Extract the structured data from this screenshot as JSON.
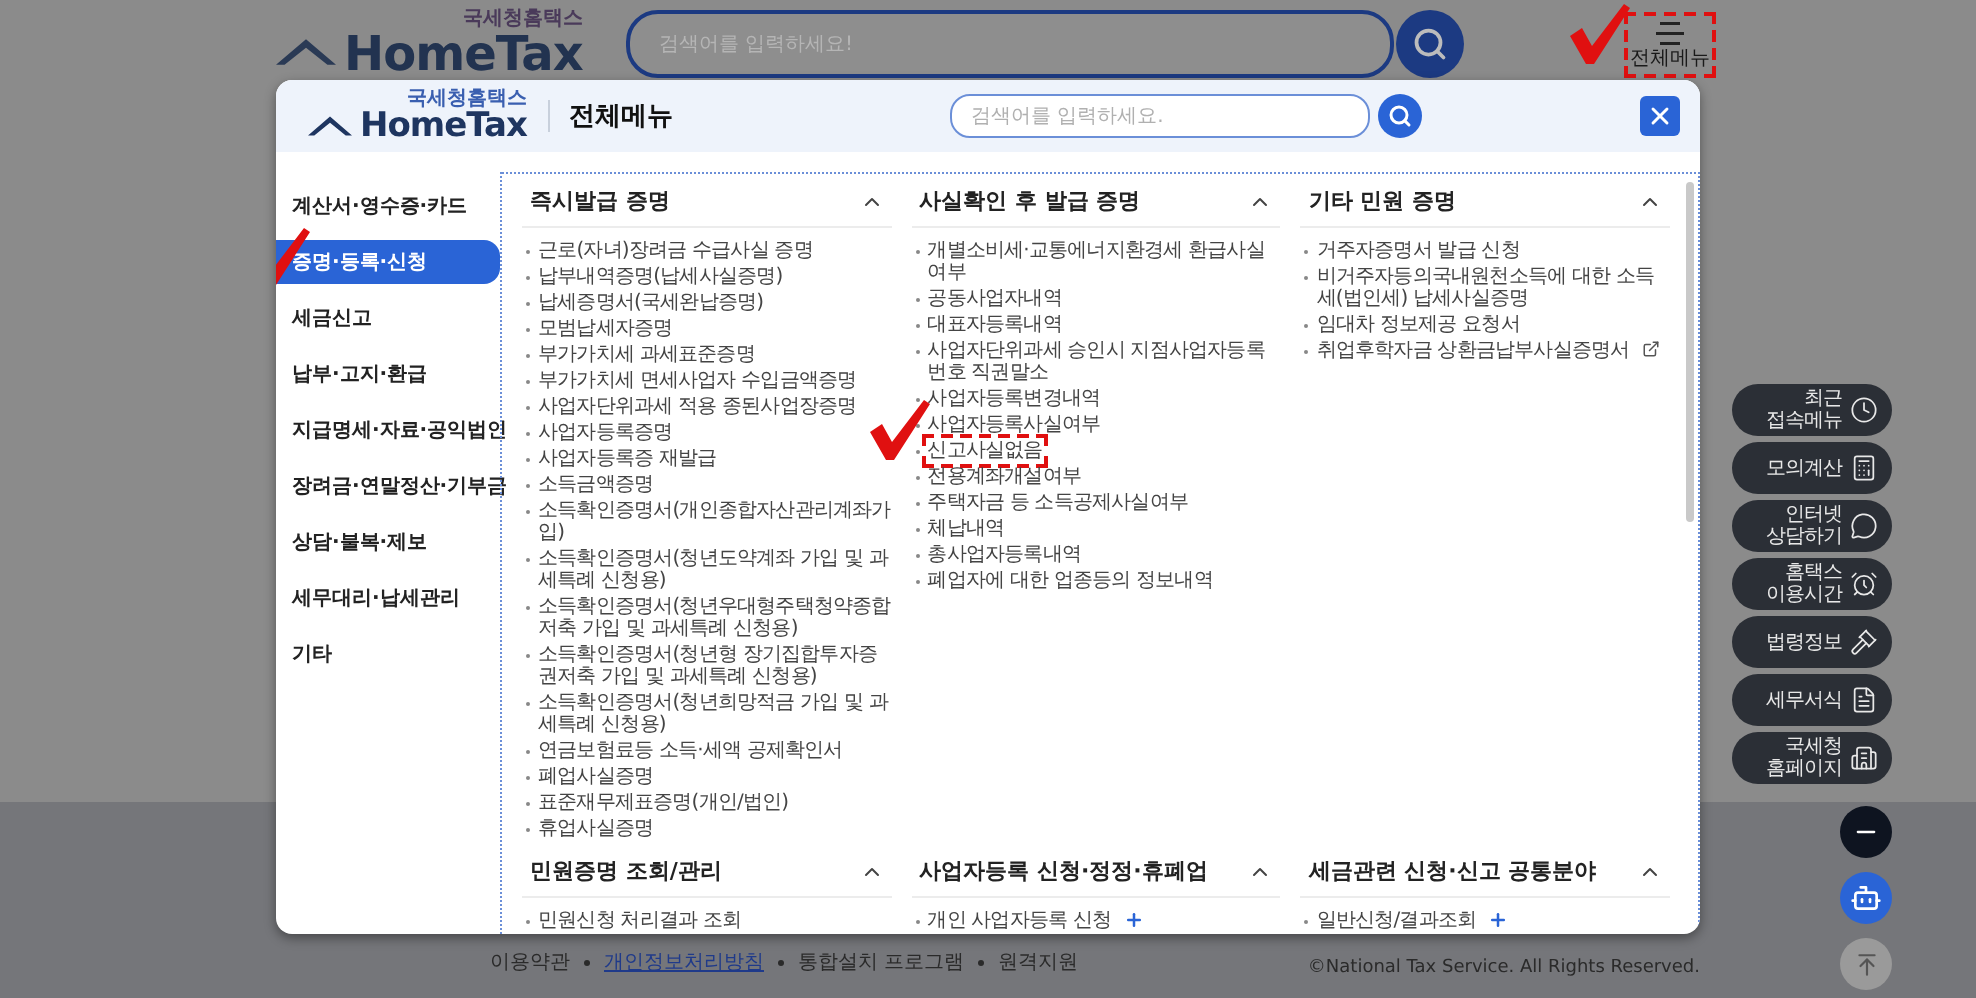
{
  "header": {
    "logo": {
      "tagline": "국세청홈택스",
      "name": "HomeTax"
    },
    "search": {
      "placeholder": "검색어를 입력하세요!"
    },
    "menu_button": {
      "label": "전체메뉴",
      "marked": true
    }
  },
  "modal": {
    "logo": {
      "tagline": "국세청홈택스",
      "name": "HomeTax"
    },
    "title": "전체메뉴",
    "search": {
      "placeholder": "검색어를 입력하세요."
    },
    "sidebar": [
      {
        "label": "계산서·영수증·카드",
        "selected": false,
        "marked": false
      },
      {
        "label": "증명·등록·신청",
        "selected": true,
        "marked": true
      },
      {
        "label": "세금신고",
        "selected": false,
        "marked": false
      },
      {
        "label": "납부·고지·환급",
        "selected": false,
        "marked": false
      },
      {
        "label": "지급명세·자료·공익법인",
        "selected": false,
        "marked": false
      },
      {
        "label": "장려금·연말정산·기부금",
        "selected": false,
        "marked": false
      },
      {
        "label": "상담·불복·제보",
        "selected": false,
        "marked": false
      },
      {
        "label": "세무대리·납세관리",
        "selected": false,
        "marked": false
      },
      {
        "label": "기타",
        "selected": false,
        "marked": false
      }
    ],
    "sections": [
      {
        "title": "즉시발급 증명",
        "expanded": true,
        "items": [
          {
            "label": "근로(자녀)장려금 수급사실 증명",
            "kind": "link"
          },
          {
            "label": "납부내역증명(납세사실증명)",
            "kind": "link"
          },
          {
            "label": "납세증명서(국세완납증명)",
            "kind": "link"
          },
          {
            "label": "모범납세자증명",
            "kind": "link"
          },
          {
            "label": "부가가치세 과세표준증명",
            "kind": "link"
          },
          {
            "label": "부가가치세 면세사업자 수입금액증명",
            "kind": "link"
          },
          {
            "label": "사업자단위과세 적용 종된사업장증명",
            "kind": "link"
          },
          {
            "label": "사업자등록증명",
            "kind": "link"
          },
          {
            "label": "사업자등록증 재발급",
            "kind": "link"
          },
          {
            "label": "소득금액증명",
            "kind": "link"
          },
          {
            "label": "소득확인증명서(개인종합자산관리계좌가입)",
            "kind": "link"
          },
          {
            "label": "소득확인증명서(청년도약계좌 가입 및 과세특례 신청용)",
            "kind": "link"
          },
          {
            "label": "소득확인증명서(청년우대형주택청약종합저축 가입 및 과세특례 신청용)",
            "kind": "link"
          },
          {
            "label": "소득확인증명서(청년형 장기집합투자증권저축 가입 및 과세특례 신청용)",
            "kind": "link"
          },
          {
            "label": "소득확인증명서(청년희망적금 가입 및 과세특례 신청용)",
            "kind": "link"
          },
          {
            "label": "연금보험료등 소득·세액 공제확인서",
            "kind": "link"
          },
          {
            "label": "폐업사실증명",
            "kind": "link"
          },
          {
            "label": "표준재무제표증명(개인/법인)",
            "kind": "link"
          },
          {
            "label": "휴업사실증명",
            "kind": "link"
          }
        ]
      },
      {
        "title": "사실확인 후 발급 증명",
        "expanded": true,
        "items": [
          {
            "label": "개별소비세·교통에너지환경세 환급사실여부",
            "kind": "link"
          },
          {
            "label": "공동사업자내역",
            "kind": "link"
          },
          {
            "label": "대표자등록내역",
            "kind": "link"
          },
          {
            "label": "사업자단위과세 승인시 지점사업자등록번호 직권말소",
            "kind": "link"
          },
          {
            "label": "사업자등록변경내역",
            "kind": "link"
          },
          {
            "label": "사업자등록사실여부",
            "kind": "link"
          },
          {
            "label": "신고사실없음",
            "kind": "marked"
          },
          {
            "label": "전용계좌개설여부",
            "kind": "link"
          },
          {
            "label": "주택자금 등 소득공제사실여부",
            "kind": "link"
          },
          {
            "label": "체납내역",
            "kind": "link"
          },
          {
            "label": "총사업자등록내역",
            "kind": "link"
          },
          {
            "label": "폐업자에 대한 업종등의 정보내역",
            "kind": "link"
          }
        ]
      },
      {
        "title": "기타 민원 증명",
        "expanded": true,
        "items": [
          {
            "label": "거주자증명서 발급 신청",
            "kind": "link"
          },
          {
            "label": "비거주자등의국내원천소득에 대한 소득세(법인세) 납세사실증명",
            "kind": "link"
          },
          {
            "label": "임대차 정보제공 요청서",
            "kind": "link"
          },
          {
            "label": "취업후학자금 상환금납부사실증명서",
            "kind": "external"
          }
        ]
      },
      {
        "title": "민원증명 조회/관리",
        "expanded": true,
        "items": [
          {
            "label": "민원신청 처리결과 조회",
            "kind": "link"
          }
        ]
      },
      {
        "title": "사업자등록 신청·정정·휴폐업",
        "expanded": true,
        "items": [
          {
            "label": "개인 사업자등록 신청",
            "kind": "expandable"
          }
        ]
      },
      {
        "title": "세금관련 신청·신고 공통분야",
        "expanded": true,
        "items": [
          {
            "label": "일반신청/결과조회",
            "kind": "expandable"
          }
        ]
      }
    ]
  },
  "floating_menu": [
    {
      "label": "최근\n접속메뉴"
    },
    {
      "label": "모의계산"
    },
    {
      "label": "인터넷\n상담하기"
    },
    {
      "label": "홈택스\n이용시간"
    },
    {
      "label": "법령정보"
    },
    {
      "label": "세무서식"
    },
    {
      "label": "국세청\n홈페이지"
    }
  ],
  "footer": {
    "links": [
      {
        "label": "이용약관",
        "kind": "plain"
      },
      {
        "label": "개인정보처리방침",
        "kind": "emphasis"
      },
      {
        "label": "통합설치 프로그램",
        "kind": "plain"
      },
      {
        "label": "원격지원",
        "kind": "plain"
      }
    ],
    "copyright": "©National Tax Service. All Rights Reserved."
  }
}
